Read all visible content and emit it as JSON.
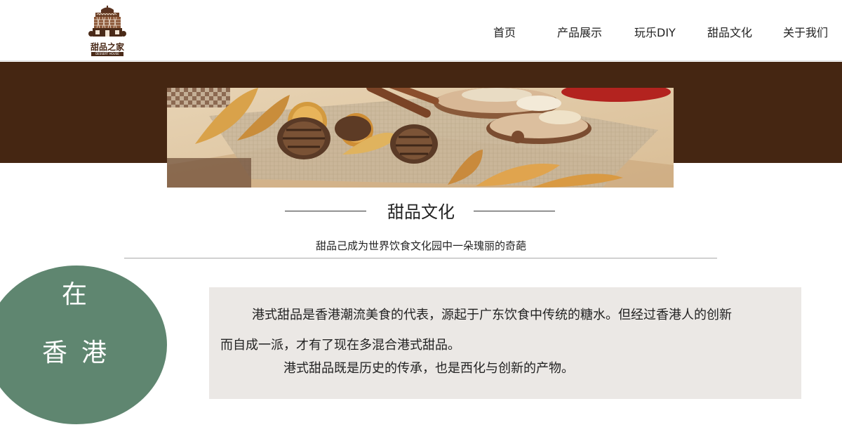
{
  "header": {
    "logo": {
      "name": "甜品之家",
      "sub": "DESSERT HOUSE",
      "colors": {
        "brown": "#4a2a18"
      }
    },
    "nav": [
      {
        "label": "首页"
      },
      {
        "label": "产品展示"
      },
      {
        "label": "玩乐DIY"
      },
      {
        "label": "甜品文化"
      },
      {
        "label": "关于我们"
      }
    ]
  },
  "band": {
    "color": "#452612"
  },
  "section": {
    "title": "甜品文化",
    "subtitle": "甜品己成为世界饮食文化园中一朵瑰丽的奇葩"
  },
  "circle": {
    "color": "#5f8670",
    "chars": [
      "在",
      "香",
      "港"
    ]
  },
  "content": {
    "line1": "港式甜品是香港潮流美食的代表，源起于广东饮食中传统的糖水。但经过香港人的创新",
    "line2": "而自成一派，才有了现在多混合港式甜品。",
    "line3": "港式甜品既是历史的传承，也是西化与创新的产物。"
  }
}
